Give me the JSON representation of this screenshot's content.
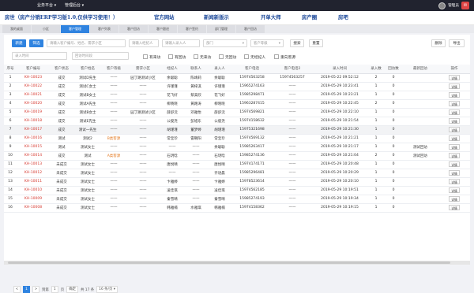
{
  "topbar": {
    "menu1": "业务平台 ▾",
    "menu2": "管理后台 ▾",
    "user": "管理员",
    "notify": "✉"
  },
  "banner": {
    "b1": "房世（房产分销ERP学习版1.0,仅供学习使用！）",
    "b2": "官方网站",
    "b3": "新闻新版示",
    "b4": "开单大师",
    "b5": "房产圈",
    "b6": "房吧"
  },
  "tabs": [
    "我的桌面",
    "小区",
    "客户管理",
    "客户列表",
    "客户回访",
    "客户跟进",
    "客户签约",
    "部门管理",
    "客户回访"
  ],
  "toolbar": {
    "new": "新建",
    "filter": "筛选",
    "search_ph": "请输入客户编号、姓名、需求小区",
    "agent_ph": "请输入经纪人",
    "staff_ph": "请输入录入人",
    "dept_ph": "部门",
    "status_ph": "客户等级",
    "search_btn": "搜索",
    "reset_btn": "重置",
    "del_btn": "删除",
    "export_btn": "导出"
  },
  "row2": {
    "name_ph": "录入时间",
    "time_ph": "回访时间段",
    "checks": [
      "有来访",
      "有回访",
      "无来访",
      "无回访",
      "无经纪人",
      "重向客源"
    ]
  },
  "columns": [
    "序号",
    "客户编号",
    "客户状态",
    "客户姓名",
    "客户等级",
    "需求小区",
    "经纪人",
    "联系人",
    "录入人",
    "客户电话",
    "客户电话2",
    "录入时间",
    "录入数",
    "回访数",
    "最新回访",
    "操作"
  ],
  "rows": [
    {
      "n": "1",
      "code": "KH-10023",
      "status": "成交",
      "name": "测试D先生",
      "level": "——",
      "area": "园丁路测试小区",
      "agent": "余聪聪",
      "contact": "陈靖莉",
      "entry": "余聪聪",
      "phone": "15974563258",
      "phone2": "15974563257",
      "time": "2019-05-22 09:52:12",
      "c1": "2",
      "c2": "0",
      "latest": "",
      "op": "详情"
    },
    {
      "n": "2",
      "code": "KH-10022",
      "status": "成交",
      "name": "测试C女士",
      "level": "——",
      "area": "——",
      "agent": "许瑾瑾",
      "contact": "黄梓淇",
      "entry": "许瑾瑾",
      "phone": "15965274163",
      "phone2": "——",
      "time": "2019-05-29 10:23:41",
      "c1": "1",
      "c2": "0",
      "latest": "",
      "op": "详情"
    },
    {
      "n": "3",
      "code": "KH-10021",
      "status": "成交",
      "name": "测试B女士",
      "level": "——",
      "area": "——",
      "agent": "花飞好",
      "contact": "蔡美欣",
      "entry": "花飞好",
      "phone": "15985298471",
      "phone2": "——",
      "time": "2019-05-29 10:23:21",
      "c1": "1",
      "c2": "0",
      "latest": "",
      "op": "详情"
    },
    {
      "n": "4",
      "code": "KH-10020",
      "status": "成交",
      "name": "测试A先生",
      "level": "——",
      "area": "——",
      "agent": "柳晓晓",
      "contact": "黄路涛",
      "entry": "柳晓晓",
      "phone": "15963287415",
      "phone2": "——",
      "time": "2019-05-29 10:22:45",
      "c1": "2",
      "c2": "0",
      "latest": "",
      "op": "详情"
    },
    {
      "n": "5",
      "code": "KH-10019",
      "status": "成交",
      "name": "测试B女士",
      "level": "——",
      "area": "园丁路测试小区",
      "agent": "薛舒沅",
      "contact": "邓雅怡",
      "entry": "薛舒沅",
      "phone": "15974569821",
      "phone2": "——",
      "time": "2019-05-29 10:22:10",
      "c1": "1",
      "c2": "0",
      "latest": "",
      "op": "详情"
    },
    {
      "n": "6",
      "code": "KH-10018",
      "status": "成交",
      "name": "测试E先生",
      "level": "——",
      "area": "——",
      "agent": "公俊尧",
      "contact": "彭旭东",
      "entry": "公俊尧",
      "phone": "15974158632",
      "phone2": "——",
      "time": "2019-05-29 10:21:54",
      "c1": "1",
      "c2": "0",
      "latest": "",
      "op": "详情"
    },
    {
      "n": "7",
      "code": "KH-10017",
      "status": "成交",
      "name": "测试一先生",
      "level": "——",
      "area": "——",
      "agent": "胡瑾瑾",
      "contact": "董梦婷",
      "entry": "胡瑾瑾",
      "phone": "15975321698",
      "phone2": "——",
      "time": "2019-05-29 10:21:30",
      "c1": "1",
      "c2": "0",
      "latest": "",
      "op": "详情"
    },
    {
      "n": "8",
      "code": "KH-10016",
      "status": "测试",
      "name": "测试2",
      "level": "B类客源",
      "area": "——",
      "agent": "常宝珍",
      "contact": "雷朝阳",
      "entry": "常宝珍",
      "phone": "15974569132",
      "phone2": "——",
      "time": "2019-05-29 10:21:21",
      "c1": "1",
      "c2": "0",
      "latest": "",
      "op": "详情"
    },
    {
      "n": "9",
      "code": "KH-10015",
      "status": "测试",
      "name": "测试女士",
      "level": "——",
      "area": "——",
      "agent": "——",
      "contact": "——",
      "entry": "余聪聪",
      "phone": "15985263417",
      "phone2": "——",
      "time": "2019-05-29 10:21:17",
      "c1": "1",
      "c2": "0",
      "latest": "测试回访",
      "op": "详情"
    },
    {
      "n": "10",
      "code": "KH-10014",
      "status": "成交",
      "name": "测试",
      "level": "A类客源",
      "area": "——",
      "agent": "石玥晗",
      "contact": "——",
      "entry": "石玥晗",
      "phone": "15985274136",
      "phone2": "——",
      "time": "2019-05-29 10:21:04",
      "c1": "2",
      "c2": "0",
      "latest": "测试回访",
      "op": "详情"
    },
    {
      "n": "11",
      "code": "KH-10013",
      "status": "未成交",
      "name": "测试女士",
      "level": "——",
      "area": "——",
      "agent": "唐悦晴",
      "contact": "——",
      "entry": "唐悦晴",
      "phone": "15974174171",
      "phone2": "——",
      "time": "2019-05-29 10:20:48",
      "c1": "1",
      "c2": "0",
      "latest": "",
      "op": "详情"
    },
    {
      "n": "12",
      "code": "KH-10012",
      "status": "未成交",
      "name": "测试女士",
      "level": "——",
      "area": "——",
      "agent": "——",
      "contact": "——",
      "entry": "齐语晨",
      "phone": "15985296481",
      "phone2": "——",
      "time": "2019-05-29 10:20:29",
      "c1": "1",
      "c2": "0",
      "latest": "",
      "op": "详情"
    },
    {
      "n": "13",
      "code": "KH-10011",
      "status": "未成交",
      "name": "测试女士",
      "level": "——",
      "area": "——",
      "agent": "卞雅婷",
      "contact": "——",
      "entry": "卞雅婷",
      "phone": "15978523614",
      "phone2": "——",
      "time": "2019-05-29 10:20:10",
      "c1": "1",
      "c2": "0",
      "latest": "",
      "op": "详情"
    },
    {
      "n": "14",
      "code": "KH-10010",
      "status": "未成交",
      "name": "测试女士",
      "level": "——",
      "area": "——",
      "agent": "凌佳琪",
      "contact": "——",
      "entry": "凌佳琪",
      "phone": "15974562185",
      "phone2": "——",
      "time": "2019-05-29 10:19:51",
      "c1": "1",
      "c2": "0",
      "latest": "",
      "op": "详情"
    },
    {
      "n": "15",
      "code": "KH-10009",
      "status": "未成交",
      "name": "测试女士",
      "level": "——",
      "area": "——",
      "agent": "秦雪晴",
      "contact": "——",
      "entry": "秦雪晴",
      "phone": "15985274193",
      "phone2": "——",
      "time": "2019-05-29 10:19:34",
      "c1": "1",
      "c2": "0",
      "latest": "",
      "op": "详情"
    },
    {
      "n": "16",
      "code": "KH-10008",
      "status": "未成交",
      "name": "测试女士",
      "level": "——",
      "area": "——",
      "agent": "韩雅楠",
      "contact": "水雅琪",
      "entry": "韩雅楠",
      "phone": "15974158362",
      "phone2": "——",
      "time": "2019-05-29 10:19:15",
      "c1": "1",
      "c2": "0",
      "latest": "",
      "op": "详情"
    }
  ],
  "pager": {
    "prev": "<",
    "page1": "1",
    "next": ">",
    "goto": "到第",
    "page_input": "1",
    "page_unit": "页",
    "ok": "确定",
    "total": "共 17 条",
    "size": "16 条/页 ▾"
  },
  "colors": {
    "accent": "#2f83e0",
    "code": "#d6382f",
    "warn": "#e47a22",
    "topbar": "#21232f"
  }
}
